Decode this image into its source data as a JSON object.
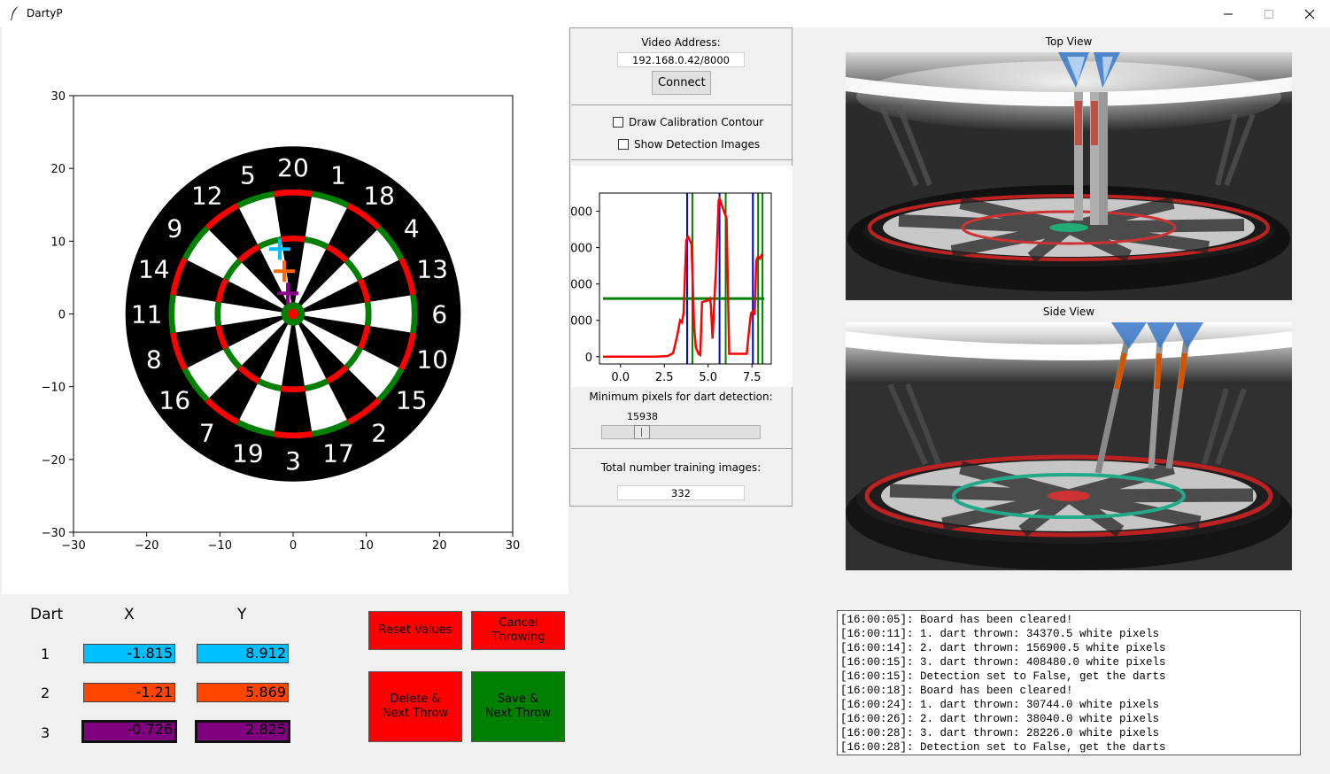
{
  "window": {
    "title": "DartyP"
  },
  "dartboard_plot": {
    "chart_data": {
      "type": "scatter",
      "title": "",
      "xlabel": "",
      "ylabel": "",
      "xlim": [
        -30,
        30
      ],
      "ylim": [
        -30,
        30
      ],
      "x_ticks": [
        "−30",
        "−20",
        "−10",
        "0",
        "10",
        "20",
        "30"
      ],
      "y_ticks": [
        "30",
        "20",
        "10",
        "0",
        "−10",
        "−20",
        "−30"
      ],
      "grid": false,
      "sector_numbers": [
        "20",
        "1",
        "18",
        "4",
        "13",
        "6",
        "10",
        "15",
        "2",
        "17",
        "3",
        "19",
        "7",
        "16",
        "8",
        "11",
        "14",
        "9",
        "12",
        "5"
      ],
      "series": [
        {
          "x": -1.815,
          "y": 8.912,
          "marker": "+",
          "color": "#00bfff"
        },
        {
          "x": -1.21,
          "y": 5.869,
          "marker": "+",
          "color": "#ff6a00"
        },
        {
          "x": -0.726,
          "y": 2.825,
          "marker": "+",
          "color": "#8b008b"
        }
      ]
    }
  },
  "settings": {
    "video_address_label": "Video Address:",
    "video_address_value": "192.168.0.42/8000",
    "connect_label": "Connect",
    "draw_calibration_label": "Draw Calibration Contour",
    "draw_calibration_checked": false,
    "show_detection_label": "Show Detection Images",
    "show_detection_checked": false,
    "min_pixels_label": "Minimum pixels for dart detection:",
    "min_pixels_value": "15938",
    "slider_fraction": 0.23,
    "training_images_label": "Total number training images:",
    "training_images_value": "332"
  },
  "detection_chart": {
    "chart_data": {
      "type": "line",
      "title": "",
      "xlabel": "",
      "ylabel": "",
      "xlim": [
        -1.2,
        8.6
      ],
      "ylim": [
        -200,
        4500
      ],
      "x_ticks": [
        "0.0",
        "2.5",
        "5.0",
        "7.5"
      ],
      "y_tick_labels_partial": [
        "000",
        "000",
        "000",
        "000",
        "0"
      ],
      "series": [
        {
          "name": "",
          "color": "#ff0000",
          "x": [
            -1.0,
            0.0,
            1.0,
            2.0,
            2.7,
            3.0,
            3.2,
            3.4,
            3.5,
            3.6,
            3.75,
            3.85,
            4.05,
            4.2,
            4.3,
            4.45,
            4.55,
            4.65,
            5.0,
            5.1,
            5.15,
            5.25,
            5.4,
            5.45,
            5.6,
            5.65,
            5.9,
            6.05,
            6.2,
            7.2,
            7.35,
            7.45,
            7.55,
            7.65,
            7.75,
            7.85,
            7.95,
            8.05,
            8.15
          ],
          "y": [
            0,
            0,
            0,
            0,
            20,
            100,
            500,
            1000,
            950,
            1200,
            3200,
            3300,
            3100,
            800,
            250,
            80,
            50,
            1500,
            1550,
            1600,
            1450,
            500,
            2000,
            2400,
            4300,
            4350,
            4000,
            3800,
            80,
            80,
            800,
            1200,
            1250,
            1150,
            2650,
            2750,
            2700,
            2800,
            2800
          ]
        }
      ],
      "threshold": 1600,
      "threshold_color": "#008000",
      "vlines_blue": [
        3.8,
        5.65,
        7.55
      ],
      "vlines_green": [
        4.1,
        6.0,
        7.85,
        8.1
      ]
    }
  },
  "views": {
    "top_title": "Top View",
    "side_title": "Side View"
  },
  "darts_table": {
    "header_dart": "Dart",
    "header_x": "X",
    "header_y": "Y",
    "rows": [
      {
        "num": "1",
        "x": "-1.815",
        "y": "8.912",
        "color": "#00bfff"
      },
      {
        "num": "2",
        "x": "-1.21",
        "y": "5.869",
        "color": "#ff4500"
      },
      {
        "num": "3",
        "x": "-0.726",
        "y": "2.825",
        "color": "#800080"
      }
    ]
  },
  "buttons": {
    "reset": "Reset Values",
    "cancel": "Cancel Throwing",
    "delete_next": "Delete &\nNext Throw",
    "save_next": "Save &\nNext Throw",
    "red": "#ff0000",
    "green": "#008000"
  },
  "log": {
    "lines": [
      "[16:00:05]: Board has been cleared!",
      "[16:00:11]: 1. dart thrown: 34370.5 white pixels",
      "[16:00:14]: 2. dart thrown: 156900.5 white pixels",
      "[16:00:15]: 3. dart thrown: 408480.0 white pixels",
      "[16:00:15]: Detection set to False, get the darts",
      "[16:00:18]: Board has been cleared!",
      "[16:00:24]: 1. dart thrown: 30744.0 white pixels",
      "[16:00:26]: 2. dart thrown: 38040.0 white pixels",
      "[16:00:28]: 3. dart thrown: 28226.0 white pixels",
      "[16:00:28]: Detection set to False, get the darts"
    ]
  }
}
